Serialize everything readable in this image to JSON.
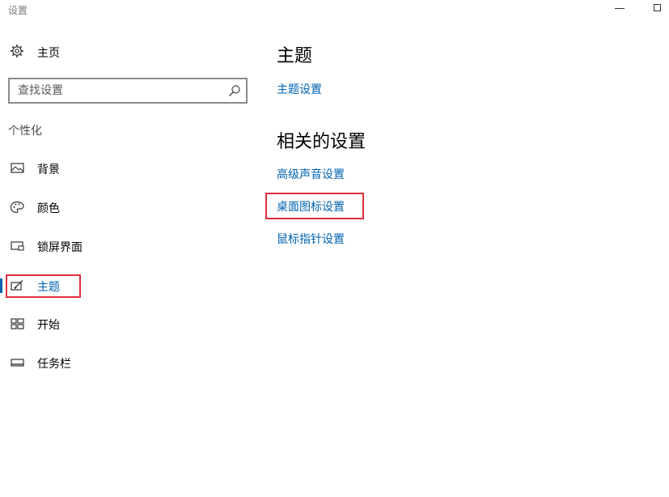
{
  "window": {
    "title": "设置",
    "minimize_icon": "minimize-icon",
    "maximize_icon": "maximize-icon"
  },
  "sidebar": {
    "home": {
      "label": "主页",
      "icon": "gear-icon"
    },
    "search": {
      "placeholder": "查找设置",
      "value": "",
      "icon": "search-icon"
    },
    "section_title": "个性化",
    "items": [
      {
        "label": "背景",
        "icon": "image-icon",
        "active": false
      },
      {
        "label": "颜色",
        "icon": "palette-icon",
        "active": false
      },
      {
        "label": "锁屏界面",
        "icon": "lock-screen-icon",
        "active": false
      },
      {
        "label": "主题",
        "icon": "theme-brush-icon",
        "active": true
      },
      {
        "label": "开始",
        "icon": "start-grid-icon",
        "active": false
      },
      {
        "label": "任务栏",
        "icon": "taskbar-icon",
        "active": false
      }
    ]
  },
  "main": {
    "title": "主题",
    "theme_settings_link": "主题设置",
    "related_title": "相关的设置",
    "related_links": [
      "高级声音设置",
      "桌面图标设置",
      "鼠标指针设置"
    ]
  },
  "colors": {
    "accent": "#0063b1",
    "highlight": "#e0303c",
    "muted": "#7a7a7a"
  }
}
